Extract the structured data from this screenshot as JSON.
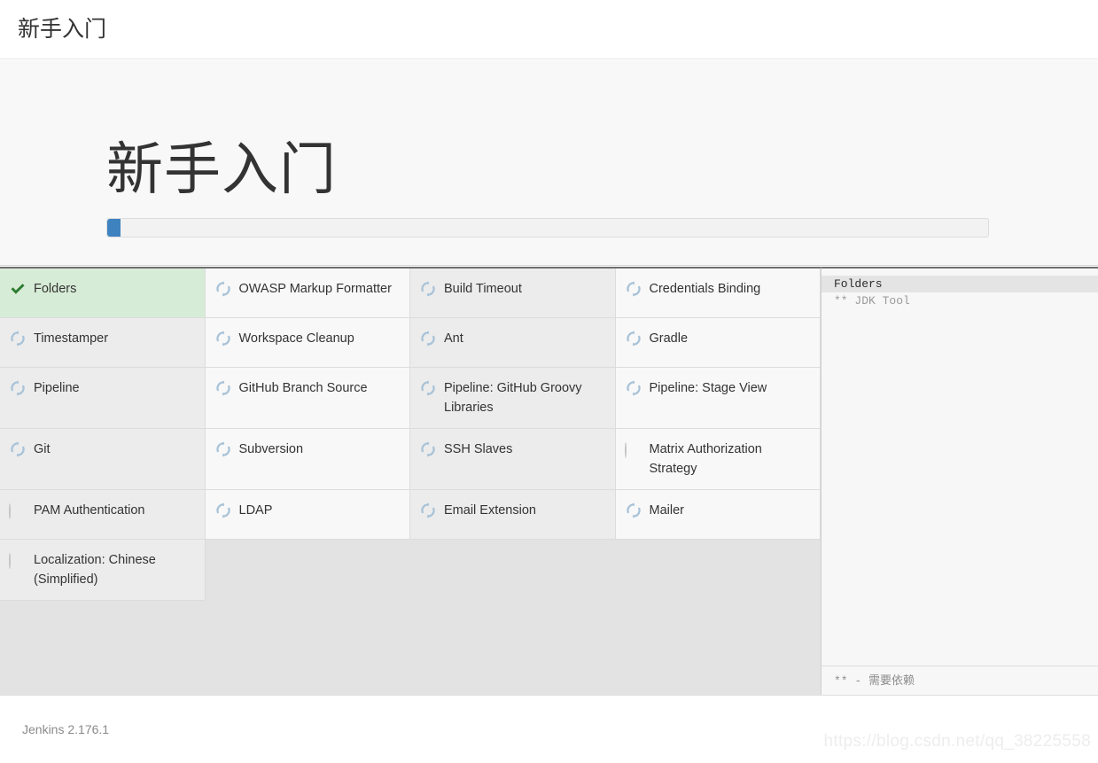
{
  "header": {
    "title": "新手入门"
  },
  "hero": {
    "title": "新手入门",
    "progress_percent": 1.5
  },
  "plugins": {
    "columns": 4,
    "rows": [
      [
        {
          "name": "Folders",
          "status": "done"
        },
        {
          "name": "OWASP Markup Formatter",
          "status": "installing"
        },
        {
          "name": "Build Timeout",
          "status": "installing"
        },
        {
          "name": "Credentials Binding",
          "status": "installing"
        }
      ],
      [
        {
          "name": "Timestamper",
          "status": "installing"
        },
        {
          "name": "Workspace Cleanup",
          "status": "installing"
        },
        {
          "name": "Ant",
          "status": "installing"
        },
        {
          "name": "Gradle",
          "status": "installing"
        }
      ],
      [
        {
          "name": "Pipeline",
          "status": "installing"
        },
        {
          "name": "GitHub Branch Source",
          "status": "installing"
        },
        {
          "name": "Pipeline: GitHub Groovy Libraries",
          "status": "installing"
        },
        {
          "name": "Pipeline: Stage View",
          "status": "installing"
        }
      ],
      [
        {
          "name": "Git",
          "status": "installing"
        },
        {
          "name": "Subversion",
          "status": "installing"
        },
        {
          "name": "SSH Slaves",
          "status": "installing"
        },
        {
          "name": "Matrix Authorization Strategy",
          "status": "pending"
        }
      ],
      [
        {
          "name": "PAM Authentication",
          "status": "pending"
        },
        {
          "name": "LDAP",
          "status": "installing"
        },
        {
          "name": "Email Extension",
          "status": "installing"
        },
        {
          "name": "Mailer",
          "status": "installing"
        }
      ],
      [
        {
          "name": "Localization: Chinese (Simplified)",
          "status": "pending"
        },
        {
          "name": "",
          "status": "empty"
        },
        {
          "name": "",
          "status": "empty"
        },
        {
          "name": "",
          "status": "empty"
        }
      ]
    ]
  },
  "log": {
    "lines": [
      {
        "text": "Folders",
        "type": "current"
      },
      {
        "text": "** JDK Tool",
        "type": "dep"
      }
    ],
    "footer_note": "** - 需要依赖"
  },
  "footer": {
    "version": "Jenkins 2.176.1"
  },
  "watermark": "https://blog.csdn.net/qq_38225558",
  "colors": {
    "accent_blue": "#3e83c0",
    "done_green": "#2e7d32",
    "done_bg": "#d7ecd7",
    "spinner_blue": "#a9c3d8",
    "pending_gray": "#c4c4c4"
  }
}
